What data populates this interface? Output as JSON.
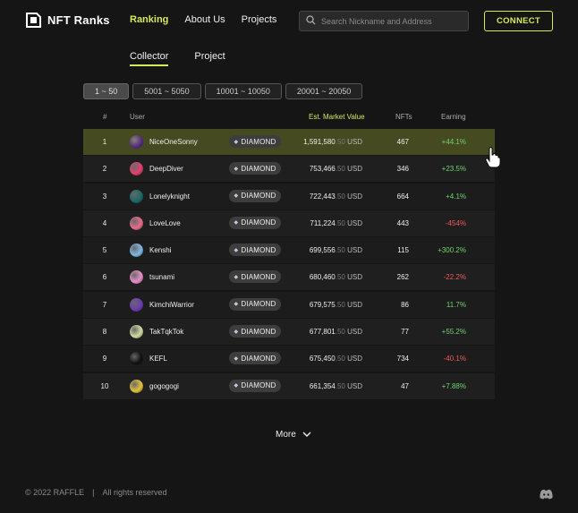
{
  "brand": {
    "name": "NFT Ranks"
  },
  "nav": [
    {
      "label": "Ranking",
      "active": true
    },
    {
      "label": "About Us",
      "active": false
    },
    {
      "label": "Projects",
      "active": false
    }
  ],
  "search": {
    "placeholder": "Search Nickname and Address"
  },
  "connect_label": "CONNECT",
  "tabs": [
    {
      "label": "Collector",
      "active": true
    },
    {
      "label": "Project",
      "active": false
    }
  ],
  "ranges": [
    {
      "label": "1 ~ 50",
      "active": true
    },
    {
      "label": "5001 ~ 5050",
      "active": false
    },
    {
      "label": "10001 ~ 10050",
      "active": false
    },
    {
      "label": "20001 ~ 20050",
      "active": false
    }
  ],
  "table": {
    "headers": {
      "rank": "#",
      "user": "User",
      "value": "Est. Market Value",
      "nfts": "NFTs",
      "earning": "Earning"
    },
    "rows": [
      {
        "rank": "1",
        "name": "NiceOneSonny",
        "badge": "DIAMOND",
        "value": "1,591,580",
        "decimal": ".50",
        "currency": "USD",
        "nfts": "467",
        "earning": "+44.1%",
        "trend": "up",
        "avatar_color": "#5a2b8a"
      },
      {
        "rank": "2",
        "name": "DeepDiver",
        "badge": "DIAMOND",
        "value": "753,466",
        "decimal": ".50",
        "currency": "USD",
        "nfts": "346",
        "earning": "+23.5%",
        "trend": "up",
        "avatar_color": "#e2406e"
      },
      {
        "rank": "3",
        "name": "Lonelyknight",
        "badge": "DIAMOND",
        "value": "722,443",
        "decimal": ".50",
        "currency": "USD",
        "nfts": "664",
        "earning": "+4.1%",
        "trend": "up",
        "avatar_color": "#1b6a6a"
      },
      {
        "rank": "4",
        "name": "LoveLove",
        "badge": "DIAMOND",
        "value": "711,224",
        "decimal": ".50",
        "currency": "USD",
        "nfts": "443",
        "earning": "-454%",
        "trend": "down",
        "avatar_color": "#e66b8a"
      },
      {
        "rank": "5",
        "name": "Kenshi",
        "badge": "DIAMOND",
        "value": "699,556",
        "decimal": ".50",
        "currency": "USD",
        "nfts": "115",
        "earning": "+300.2%",
        "trend": "up",
        "avatar_color": "#7fb7e6"
      },
      {
        "rank": "6",
        "name": "tsunami",
        "badge": "DIAMOND",
        "value": "680,460",
        "decimal": ".50",
        "currency": "USD",
        "nfts": "262",
        "earning": "-22.2%",
        "trend": "down",
        "avatar_color": "#e78fc6"
      },
      {
        "rank": "7",
        "name": "KimchiWarrior",
        "badge": "DIAMOND",
        "value": "679,575",
        "decimal": ".50",
        "currency": "USD",
        "nfts": "86",
        "earning": "11.7%",
        "trend": "up",
        "avatar_color": "#6c3cb3"
      },
      {
        "rank": "8",
        "name": "TakTqkTok",
        "badge": "DIAMOND",
        "value": "677,801",
        "decimal": ".50",
        "currency": "USD",
        "nfts": "77",
        "earning": "+55.2%",
        "trend": "up",
        "avatar_color": "#cfd9a0"
      },
      {
        "rank": "9",
        "name": "KEFL",
        "badge": "DIAMOND",
        "value": "675,450",
        "decimal": ".50",
        "currency": "USD",
        "nfts": "734",
        "earning": "-40.1%",
        "trend": "down",
        "avatar_color": "#111111"
      },
      {
        "rank": "10",
        "name": "gogogogi",
        "badge": "DIAMOND",
        "value": "661,354",
        "decimal": ".50",
        "currency": "USD",
        "nfts": "47",
        "earning": "+7.88%",
        "trend": "up",
        "avatar_color": "#e0c23a"
      }
    ]
  },
  "more_label": "More",
  "footer": {
    "copyright": "© 2022 RAFFLE",
    "separator": "|",
    "rights": "All rights reserved"
  },
  "colors": {
    "accent": "#d7e85a",
    "highlight_row": "#454a21",
    "positive": "#6ed36e",
    "negative": "#f05a5a"
  },
  "icons": {
    "search": "search-icon",
    "more": "chevron-down-icon",
    "diamond": "diamond-icon",
    "discord": "discord-icon",
    "cursor": "hand-pointer-icon"
  }
}
